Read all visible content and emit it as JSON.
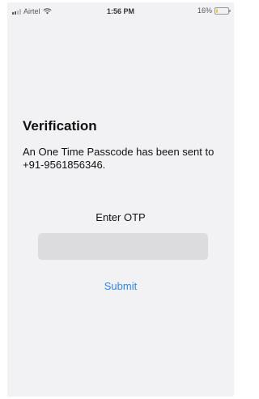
{
  "status_bar": {
    "carrier": "Airtel",
    "time": "1:56 PM",
    "battery_percent": "16%",
    "battery_level": 0.16,
    "icons": [
      "signal-icon",
      "wifi-icon",
      "battery-icon"
    ],
    "battery_fill_color": "#f5c542"
  },
  "verification": {
    "title": "Verification",
    "message": "An One Time Passcode has been sent to +91-9561856346.",
    "otp_label": "Enter OTP",
    "otp_value": "",
    "otp_placeholder": "",
    "submit_label": "Submit"
  },
  "colors": {
    "background": "#f2f2f4",
    "input_background": "#dcdcde",
    "accent": "#2f87e0"
  }
}
